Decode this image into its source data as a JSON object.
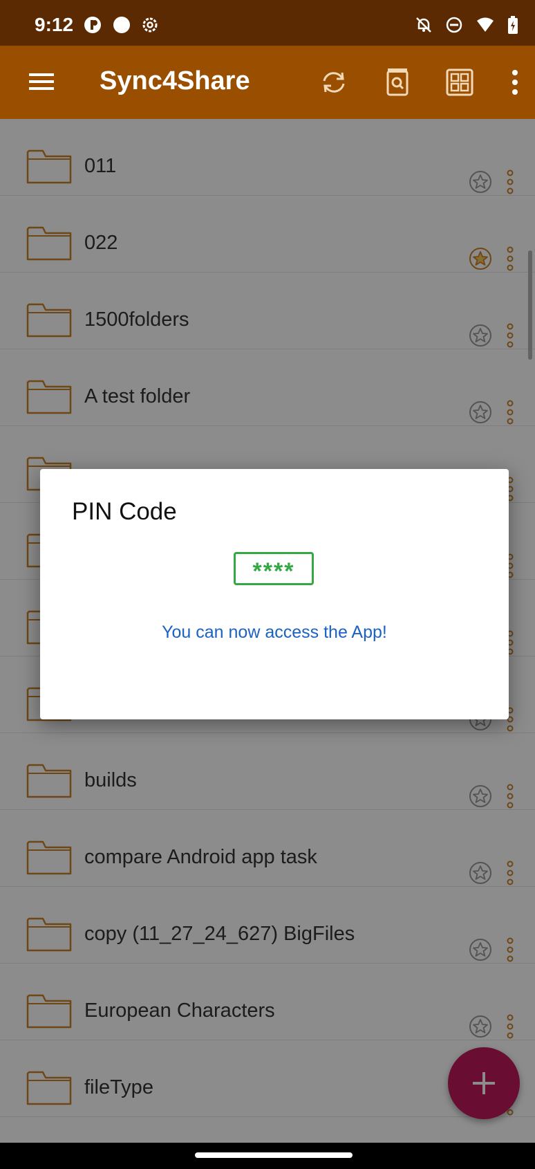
{
  "status_bar": {
    "time": "9:12"
  },
  "app_bar": {
    "title": "Sync4Share"
  },
  "folders": [
    {
      "name": "011",
      "favorite": false
    },
    {
      "name": "022",
      "favorite": true
    },
    {
      "name": "1500folders",
      "favorite": false
    },
    {
      "name": "A test folder",
      "favorite": false
    },
    {
      "name": "",
      "favorite": false
    },
    {
      "name": "",
      "favorite": false
    },
    {
      "name": "",
      "favorite": false
    },
    {
      "name": "",
      "favorite": false
    },
    {
      "name": "builds",
      "favorite": false
    },
    {
      "name": "compare Android app task",
      "favorite": false
    },
    {
      "name": "copy (11_27_24_627) BigFiles",
      "favorite": false
    },
    {
      "name": "European Characters",
      "favorite": false
    },
    {
      "name": "fileType",
      "favorite": false
    }
  ],
  "dialog": {
    "title": "PIN Code",
    "pin_value": "****",
    "message": "You can now access the App!"
  },
  "colors": {
    "status_bar": "#5b2a02",
    "app_bar": "#9a4e00",
    "folder_icon": "#c9822a",
    "fab": "#c2185b",
    "pin_border": "#35a846",
    "message": "#1a63c2"
  }
}
